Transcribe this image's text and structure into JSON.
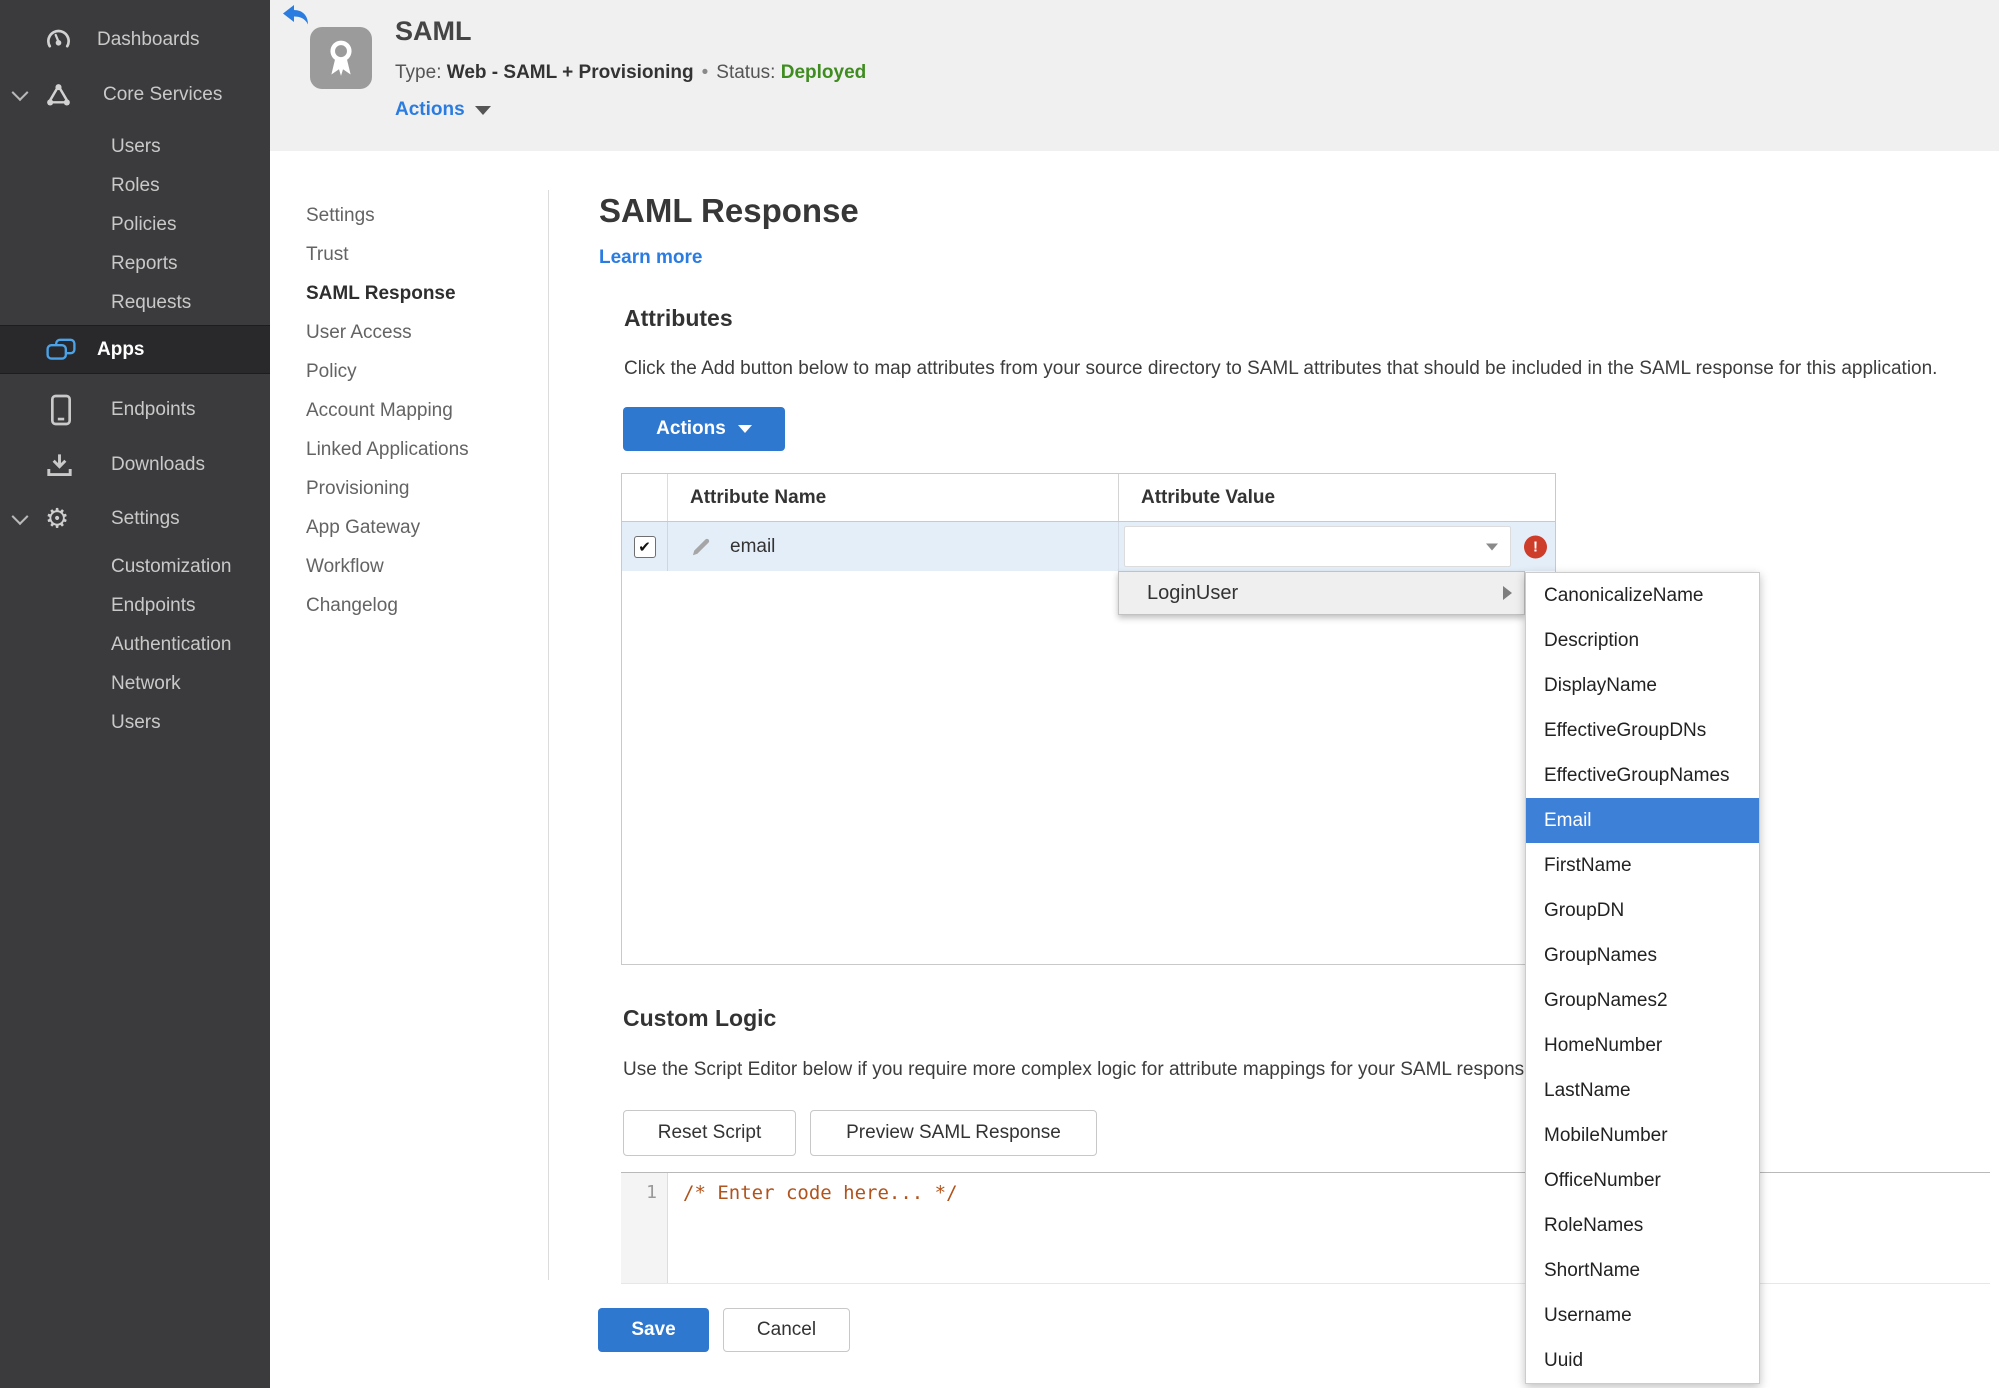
{
  "colors": {
    "accent_blue": "#2e78d0",
    "link_blue": "#2b7ce0",
    "status_green": "#3f8d20",
    "error_red": "#ce3c2a",
    "row_highlight": "#e4eef9",
    "submenu_selected": "#3c80d8",
    "sidebar_bg": "#3b3b3d",
    "code_comment": "#b0531c"
  },
  "sidebar": {
    "items": [
      "Dashboards",
      "Core Services",
      "Users",
      "Roles",
      "Policies",
      "Reports",
      "Requests",
      "Apps",
      "Endpoints",
      "Downloads",
      "Settings",
      "Customization",
      "Endpoints",
      "Authentication",
      "Network",
      "Users"
    ]
  },
  "header": {
    "title": "SAML",
    "type_label": "Type:",
    "type_value": "Web - SAML + Provisioning",
    "separator": "•",
    "status_label": "Status:",
    "status_value": "Deployed",
    "actions_label": "Actions"
  },
  "subnav": {
    "items": [
      "Settings",
      "Trust",
      "SAML Response",
      "User Access",
      "Policy",
      "Account Mapping",
      "Linked Applications",
      "Provisioning",
      "App Gateway",
      "Workflow",
      "Changelog"
    ],
    "selected": "SAML Response"
  },
  "page": {
    "title": "SAML Response",
    "learn_more": "Learn more"
  },
  "attributes": {
    "heading": "Attributes",
    "description": "Click the Add button below to map attributes from your source directory to SAML attributes that should be included in the SAML response for this application.",
    "actions_button": "Actions"
  },
  "table": {
    "columns": [
      "Attribute Name",
      "Attribute Value"
    ],
    "rows": [
      {
        "name": "email",
        "checked": "✔",
        "value": ""
      }
    ]
  },
  "context_menu": {
    "label": "LoginUser"
  },
  "submenu": {
    "selected": "Email",
    "items": [
      "CanonicalizeName",
      "Description",
      "DisplayName",
      "EffectiveGroupDNs",
      "EffectiveGroupNames",
      "Email",
      "FirstName",
      "GroupDN",
      "GroupNames",
      "GroupNames2",
      "HomeNumber",
      "LastName",
      "MobileNumber",
      "OfficeNumber",
      "RoleNames",
      "ShortName",
      "Username",
      "Uuid"
    ]
  },
  "custom_logic": {
    "heading": "Custom Logic",
    "description": "Use the Script Editor below if you require more complex logic for attribute mappings for your SAML response.",
    "reset_button": "Reset Script",
    "preview_button": "Preview SAML Response"
  },
  "editor": {
    "line_number": "1",
    "code": "/* Enter code here... */"
  },
  "footer": {
    "save": "Save",
    "cancel": "Cancel"
  },
  "error": {
    "glyph": "!"
  }
}
